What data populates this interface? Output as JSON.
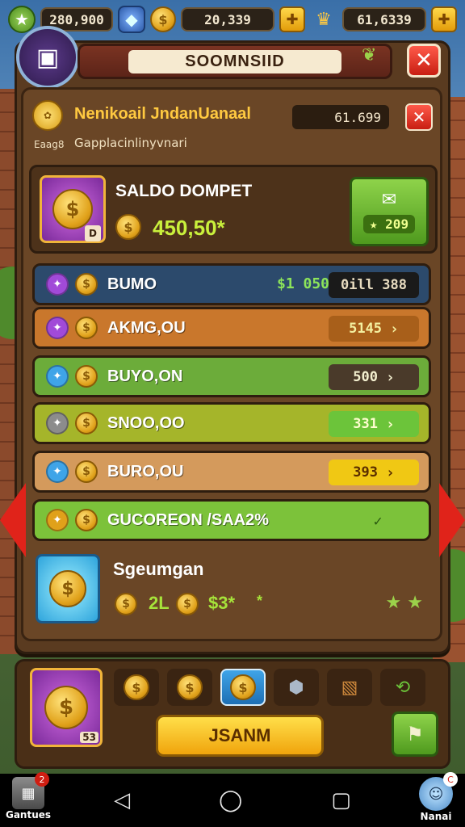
{
  "topbar": {
    "res1": "280,900",
    "res2": "20,339",
    "res3": "61,6339"
  },
  "header": {
    "title": "SOOMNSIID"
  },
  "subheader": {
    "title": "Nenikoail JndanUanaal",
    "value": "61.699",
    "small_left": "Eaag8",
    "small_text": "Gapplacinlinyvnari"
  },
  "balance": {
    "label": "SALDO DOMPET",
    "amount": "450,50*",
    "button_value": "209"
  },
  "rows": [
    {
      "label": "BUMO",
      "mid": "$1 050",
      "price": "0ill 388",
      "gem_color": "#a14ad8",
      "bg": "#2c4a6c",
      "price_bg": "#1a1a1a",
      "price_color": "#e8dcc0",
      "chev": ""
    },
    {
      "label": "AKMG,OU",
      "price": "5145",
      "gem_color": "#a14ad8",
      "bg": "#c9772c",
      "price_bg": "#a85f1a",
      "price_color": "#f4f0a0",
      "chev": "›"
    },
    {
      "label": "BUYO,ON",
      "price": "500",
      "gem_color": "#3fa4e8",
      "bg": "#6cac3a",
      "price_bg": "#4a3a2a",
      "price_color": "#f4f0d0",
      "chev": "›"
    },
    {
      "label": "SNOO,OO",
      "price": "331",
      "gem_color": "#8c8c8c",
      "bg": "#a5b52a",
      "price_bg": "#6cc43a",
      "price_color": "#fffdd0",
      "chev": "›"
    },
    {
      "label": "BURO,OU",
      "price": "393",
      "gem_color": "#3fa4e8",
      "bg": "#d49a5c",
      "price_bg": "#f0c814",
      "price_color": "#5a2e00",
      "chev": "›"
    },
    {
      "label": "GUCOREON /SAA2%",
      "price": "",
      "gem_color": "#e0a11a",
      "bg": "#7cc23a",
      "price_bg": "transparent",
      "price_color": "#2a5a10",
      "chev": "✓"
    }
  ],
  "bonus": {
    "title": "Sgeumgan",
    "value": "2L",
    "value2": "$3*",
    "star": "*"
  },
  "bottom": {
    "pack_num": "53",
    "main_button": "JSANM"
  },
  "nav": {
    "left_label": "Gantues",
    "left_badge": "2",
    "right_label": "Nanai",
    "right_badge": "C"
  },
  "colors": {
    "accent_gold": "#ffc940",
    "balance_green": "#c9f03c",
    "close_red": "#e0231a"
  }
}
